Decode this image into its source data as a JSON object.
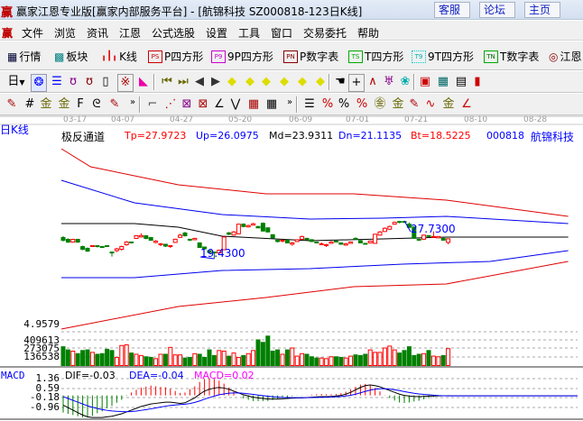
{
  "window": {
    "title": "赢家江恩专业版[赢家内部服务平台] - [航锦科技  SZ000818-123日K线]",
    "buttons": [
      "客服",
      "论坛",
      "主页"
    ]
  },
  "menu": [
    "文件",
    "浏览",
    "资讯",
    "江恩",
    "公式选股",
    "设置",
    "工具",
    "窗口",
    "交易委托",
    "帮助"
  ],
  "toolbar1": [
    "行情",
    "板块",
    "K线",
    "P四方形",
    "9P四方形",
    "P数字表",
    "T四方形",
    "9T四方形",
    "T数字表",
    "江恩"
  ],
  "toolbar2": {
    "period": "日"
  },
  "chart_header": {
    "period_label": "日K线",
    "indicator": "极反通道",
    "tp": "Tp=27.9723",
    "up": "Up=26.0975",
    "md": "Md=23.9311",
    "dn": "Dn=21.1135",
    "bt": "Bt=18.5225",
    "code": "000818",
    "name": "航锦科技"
  },
  "dates": [
    "03-17",
    "04-07",
    "04-27",
    "05-20",
    "06-09",
    "07-01",
    "07-21",
    "08-10",
    "08-28"
  ],
  "price_axis": "4.9579",
  "annotations": {
    "low": "19.4300",
    "high": "27.7300"
  },
  "volume_axis": [
    "409613",
    "273075",
    "136538"
  ],
  "macd_header": {
    "label": "MACD",
    "dif": "DIF=-0.03",
    "dea": "DEA=-0.04",
    "macd": "MACD=0.02"
  },
  "macd_axis": [
    "1.36",
    "0.59",
    "-0.18",
    "-0.96"
  ],
  "colors": {
    "up": "#ff0000",
    "down": "#008000",
    "blue": "#0000ff",
    "magenta": "#ff00ff"
  },
  "chart_data": {
    "type": "candlestick",
    "candles": [
      [
        24.08,
        23.48,
        24.4,
        23.2
      ],
      [
        23.68,
        23.08,
        23.9,
        22.9
      ],
      [
        23.08,
        23.68,
        23.8,
        23.0
      ],
      [
        23.68,
        23.08,
        23.8,
        22.9
      ],
      [
        22.1,
        21.5,
        22.3,
        21.3
      ],
      [
        21.71,
        21.11,
        21.9,
        20.9
      ],
      [
        22.1,
        22.3,
        22.4,
        22.0
      ],
      [
        22.3,
        22.1,
        22.4,
        21.9
      ],
      [
        22.1,
        21.9,
        22.2,
        21.8
      ],
      [
        22.3,
        22.1,
        22.4,
        22.0
      ],
      [
        20.9,
        20.7,
        21.0,
        19.9
      ],
      [
        21.2,
        21.6,
        21.8,
        20.9
      ],
      [
        21.5,
        22.1,
        22.3,
        21.2
      ],
      [
        22.5,
        23.1,
        23.3,
        22.3
      ],
      [
        23.1,
        22.9,
        23.2,
        22.8
      ],
      [
        23.87,
        24.47,
        24.6,
        23.8
      ],
      [
        24.2,
        24.5,
        25.0,
        24.1
      ],
      [
        24.47,
        23.87,
        24.6,
        23.7
      ],
      [
        24.08,
        23.48,
        24.2,
        23.4
      ],
      [
        23.0,
        23.3,
        23.5,
        22.8
      ],
      [
        22.5,
        22.7,
        22.9,
        22.2
      ],
      [
        22.6,
        22.2,
        22.7,
        22.0
      ],
      [
        22.1,
        22.3,
        22.4,
        21.8
      ],
      [
        23.0,
        23.7,
        23.8,
        22.9
      ],
      [
        24.1,
        24.6,
        24.9,
        24.0
      ],
      [
        25.07,
        24.47,
        25.3,
        24.3
      ],
      [
        23.7,
        23.5,
        23.8,
        23.3
      ],
      [
        23.6,
        23.9,
        24.0,
        23.5
      ],
      [
        22.9,
        21.9,
        23.0,
        21.8
      ],
      [
        22.0,
        21.6,
        22.1,
        21.4
      ],
      [
        21.2,
        20.8,
        21.3,
        20.6
      ],
      [
        20.9,
        20.7,
        21.0,
        19.43
      ],
      [
        20.7,
        21.3,
        21.4,
        20.5
      ],
      [
        21.4,
        24.2,
        24.3,
        21.3
      ],
      [
        25.1,
        24.8,
        25.3,
        24.6
      ],
      [
        24.6,
        25.3,
        25.5,
        24.5
      ],
      [
        24.9,
        27.0,
        27.1,
        24.8
      ],
      [
        27.0,
        26.5,
        27.2,
        26.3
      ],
      [
        26.4,
        26.7,
        26.9,
        26.3
      ],
      [
        26.8,
        27.1,
        27.3,
        26.7
      ],
      [
        26.5,
        26.2,
        26.6,
        26.1
      ],
      [
        27.2,
        25.5,
        27.4,
        25.4
      ],
      [
        26.2,
        25.3,
        26.3,
        25.2
      ],
      [
        24.7,
        24.0,
        24.8,
        23.9
      ],
      [
        23.5,
        23.2,
        23.6,
        23.0
      ],
      [
        23.3,
        23.5,
        23.6,
        23.0
      ],
      [
        23.5,
        22.9,
        23.6,
        22.8
      ],
      [
        22.6,
        22.9,
        23.1,
        22.3
      ],
      [
        23.2,
        23.6,
        23.7,
        23.1
      ],
      [
        23.7,
        24.3,
        24.5,
        23.6
      ],
      [
        23.9,
        23.6,
        24.0,
        23.5
      ],
      [
        23.6,
        23.2,
        23.7,
        23.1
      ],
      [
        23.1,
        22.9,
        23.2,
        22.8
      ],
      [
        22.5,
        22.7,
        23.0,
        22.4
      ],
      [
        22.3,
        22.5,
        22.7,
        22.0
      ],
      [
        22.8,
        23.1,
        23.3,
        22.7
      ],
      [
        23.3,
        23.1,
        23.4,
        23.0
      ],
      [
        22.9,
        22.6,
        23.0,
        22.5
      ],
      [
        22.4,
        22.7,
        22.9,
        22.3
      ],
      [
        22.8,
        23.1,
        23.2,
        22.7
      ],
      [
        23.9,
        23.7,
        24.1,
        23.6
      ],
      [
        23.4,
        22.9,
        23.5,
        22.8
      ],
      [
        22.8,
        22.7,
        22.9,
        22.6
      ],
      [
        22.9,
        23.3,
        23.4,
        22.8
      ],
      [
        22.8,
        24.8,
        24.9,
        22.7
      ],
      [
        24.6,
        25.3,
        25.5,
        24.5
      ],
      [
        25.4,
        26.1,
        26.3,
        25.3
      ],
      [
        25.9,
        26.5,
        26.7,
        25.8
      ],
      [
        27.0,
        27.4,
        27.6,
        26.9
      ],
      [
        27.6,
        27.4,
        27.7,
        27.2
      ],
      [
        27.6,
        27.5,
        27.73,
        27.3
      ],
      [
        27.0,
        26.3,
        27.4,
        26.2
      ],
      [
        26.4,
        23.9,
        26.5,
        23.8
      ],
      [
        23.7,
        23.5,
        23.8,
        23.3
      ],
      [
        23.7,
        24.6,
        24.7,
        23.6
      ],
      [
        24.5,
        24.3,
        24.6,
        24.2
      ],
      [
        24.1,
        24.3,
        25.4,
        24.0
      ],
      [
        24.0,
        24.3,
        24.4,
        23.9
      ],
      [
        23.9,
        23.5,
        24.0,
        23.4
      ],
      [
        23.0,
        23.8,
        23.9,
        22.6
      ]
    ],
    "channel": {
      "tp_red_upper": [
        [
          0,
          43.54
        ],
        [
          6,
          39.59
        ],
        [
          24,
          35.64
        ],
        [
          42,
          33.66
        ],
        [
          60,
          33.66
        ],
        [
          79,
          32.28
        ],
        [
          104,
          28.72
        ]
      ],
      "up_blue_upper": [
        [
          0,
          36.62
        ],
        [
          15,
          31.68
        ],
        [
          33,
          29.11
        ],
        [
          51,
          28.13
        ],
        [
          66,
          28.32
        ],
        [
          79,
          28.72
        ],
        [
          104,
          27.14
        ]
      ],
      "md_black": [
        [
          0,
          27.14
        ],
        [
          15,
          27.14
        ],
        [
          24,
          26.35
        ],
        [
          33,
          24.37
        ],
        [
          51,
          23.38
        ],
        [
          66,
          23.78
        ],
        [
          79,
          24.17
        ],
        [
          104,
          24.17
        ]
      ],
      "dn_blue_lower": [
        [
          0,
          15.28
        ],
        [
          15,
          15.28
        ],
        [
          33,
          16.86
        ],
        [
          51,
          17.26
        ],
        [
          70,
          18.24
        ],
        [
          88,
          18.84
        ],
        [
          104,
          21.21
        ]
      ],
      "bt_red_lower": [
        [
          0,
          4.01
        ],
        [
          24,
          8.96
        ],
        [
          42,
          10.93
        ],
        [
          60,
          13.3
        ],
        [
          79,
          13.9
        ],
        [
          104,
          18.84
        ]
      ]
    },
    "volume": [
      300000,
      250000,
      230000,
      190000,
      240000,
      250000,
      210000,
      180000,
      190000,
      260000,
      240000,
      130000,
      320000,
      330000,
      200000,
      180000,
      160000,
      140000,
      130000,
      110000,
      180000,
      180000,
      290000,
      170000,
      170000,
      120000,
      130000,
      190000,
      180000,
      130000,
      250000,
      160000,
      240000,
      230000,
      150000,
      200000,
      130000,
      160000,
      190000,
      240000,
      410000,
      370000,
      470000,
      230000,
      250000,
      180000,
      250000,
      280000,
      150000,
      190000,
      180000,
      140000,
      120000,
      120000,
      110000,
      140000,
      140000,
      130000,
      120000,
      150000,
      170000,
      160000,
      180000,
      250000,
      210000,
      210000,
      280000,
      310000,
      250000,
      200000,
      240000,
      300000,
      160000,
      180000,
      190000,
      240000,
      150000,
      140000,
      160000,
      270000
    ],
    "dif": [
      -0.8,
      -1.0,
      -1.2,
      -1.4,
      -1.6,
      -1.75,
      -1.8,
      -1.8,
      -1.8,
      -1.75,
      -1.7,
      -1.6,
      -1.5,
      -1.35,
      -1.2,
      -1.05,
      -0.9,
      -0.8,
      -0.7,
      -0.65,
      -0.6,
      -0.55,
      -0.55,
      -0.6,
      -0.65,
      -0.6,
      -0.4,
      -0.2,
      0.1,
      0.35,
      0.5,
      0.6,
      0.65,
      0.6,
      0.5,
      0.35,
      0.2,
      0.05,
      -0.05,
      -0.15,
      -0.2,
      -0.25,
      -0.3,
      -0.3,
      -0.3,
      -0.28,
      -0.25,
      -0.22,
      -0.2,
      -0.2,
      -0.18,
      -0.15,
      -0.12,
      -0.1,
      -0.1,
      -0.08,
      -0.05,
      0.0,
      0.1,
      0.25,
      0.45,
      0.65,
      0.8,
      0.85,
      0.8,
      0.7,
      0.55,
      0.4,
      0.25,
      0.1,
      0.0,
      -0.05,
      -0.08,
      -0.1,
      -0.08,
      -0.06,
      -0.05,
      -0.04,
      -0.03,
      -0.03
    ],
    "dea": [
      -0.1,
      -0.25,
      -0.4,
      -0.55,
      -0.7,
      -0.85,
      -0.97,
      -1.07,
      -1.15,
      -1.22,
      -1.27,
      -1.3,
      -1.32,
      -1.33,
      -1.32,
      -1.28,
      -1.22,
      -1.16,
      -1.1,
      -1.02,
      -0.95,
      -0.88,
      -0.82,
      -0.78,
      -0.75,
      -0.72,
      -0.66,
      -0.57,
      -0.45,
      -0.31,
      -0.18,
      -0.06,
      0.05,
      0.12,
      0.18,
      0.2,
      0.2,
      0.17,
      0.13,
      0.08,
      0.03,
      -0.02,
      -0.07,
      -0.11,
      -0.14,
      -0.17,
      -0.18,
      -0.19,
      -0.19,
      -0.19,
      -0.19,
      -0.18,
      -0.17,
      -0.16,
      -0.15,
      -0.13,
      -0.11,
      -0.09,
      -0.05,
      0.01,
      0.1,
      0.21,
      0.33,
      0.43,
      0.5,
      0.54,
      0.54,
      0.51,
      0.46,
      0.39,
      0.31,
      0.24,
      0.17,
      0.12,
      0.08,
      0.05,
      0.02,
      -0.01,
      -0.03,
      -0.04
    ]
  }
}
